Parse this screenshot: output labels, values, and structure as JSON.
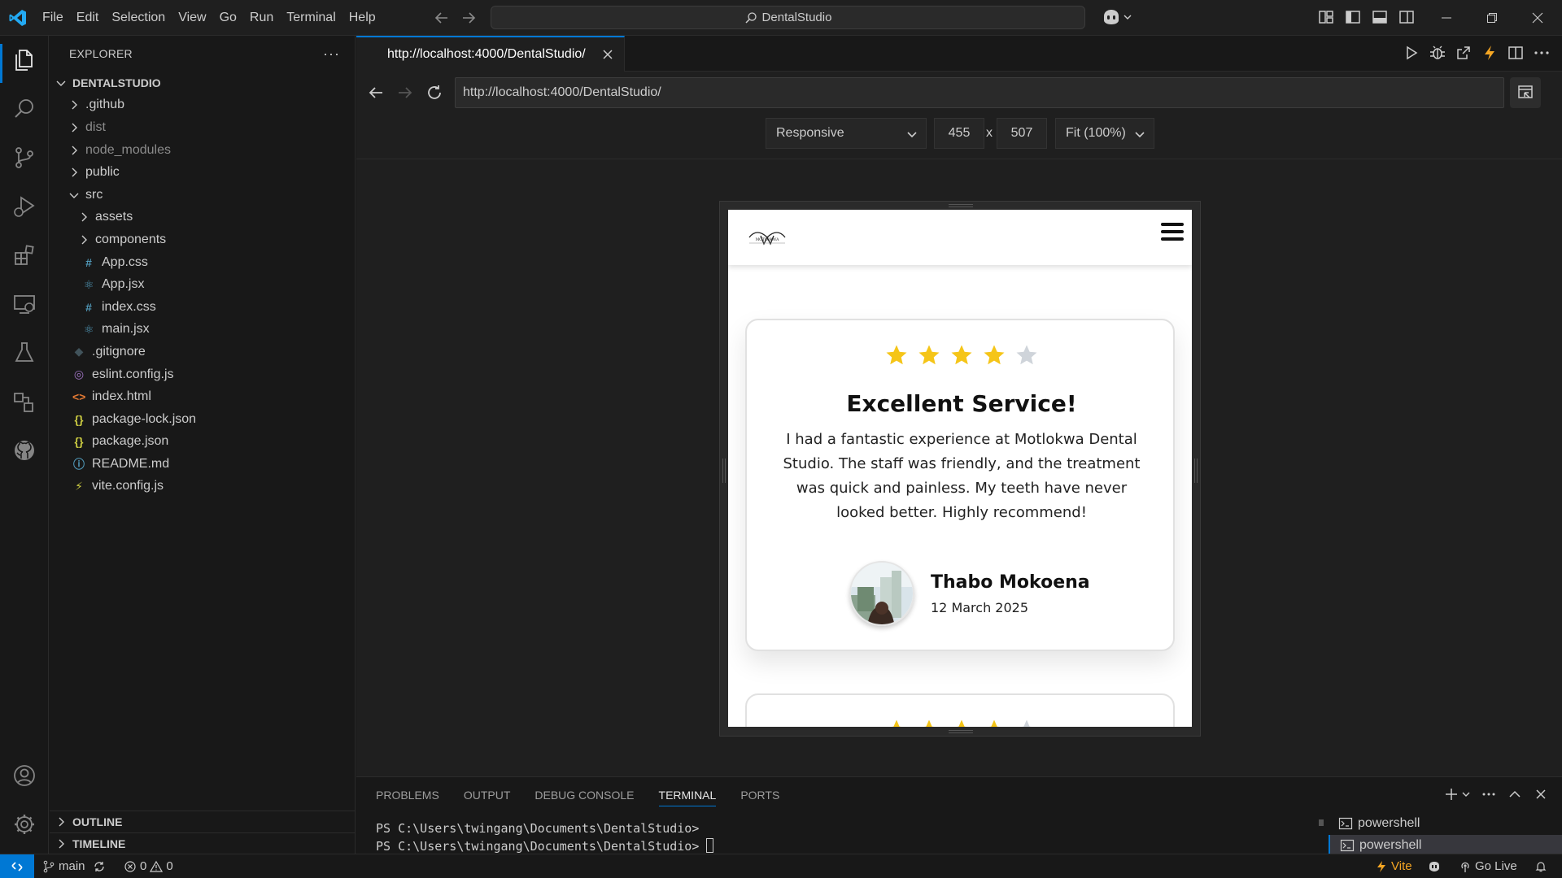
{
  "titlebar": {
    "menu": [
      "File",
      "Edit",
      "Selection",
      "View",
      "Go",
      "Run",
      "Terminal",
      "Help"
    ],
    "search_text": "DentalStudio",
    "icons": [
      "vscode-logo-icon",
      "arrow-left-icon",
      "arrow-right-icon",
      "search-icon",
      "copilot-icon",
      "customize-layout-icon",
      "toggle-sidebar-icon",
      "toggle-panel-icon",
      "toggle-secondary-sidebar-icon",
      "minimize-icon",
      "restore-icon",
      "close-icon"
    ]
  },
  "activitybar": {
    "items": [
      "explorer",
      "search",
      "source-control",
      "run-debug",
      "extensions",
      "remote-explorer",
      "testing",
      "live-share",
      "github"
    ],
    "bottom": [
      "accounts",
      "manage"
    ]
  },
  "sidebar": {
    "header": "EXPLORER",
    "more_label": "···",
    "root": "DENTALSTUDIO",
    "tree": [
      {
        "label": ".github",
        "type": "folder",
        "open": false,
        "depth": 1,
        "muted": false
      },
      {
        "label": "dist",
        "type": "folder",
        "open": false,
        "depth": 1,
        "muted": true
      },
      {
        "label": "node_modules",
        "type": "folder",
        "open": false,
        "depth": 1,
        "muted": true
      },
      {
        "label": "public",
        "type": "folder",
        "open": false,
        "depth": 1,
        "muted": false
      },
      {
        "label": "src",
        "type": "folder",
        "open": true,
        "depth": 1,
        "muted": false
      },
      {
        "label": "assets",
        "type": "folder",
        "open": false,
        "depth": 2,
        "muted": false
      },
      {
        "label": "components",
        "type": "folder",
        "open": false,
        "depth": 2,
        "muted": false
      },
      {
        "label": "App.css",
        "type": "css",
        "depth": 2
      },
      {
        "label": "App.jsx",
        "type": "react",
        "depth": 2
      },
      {
        "label": "index.css",
        "type": "css",
        "depth": 2
      },
      {
        "label": "main.jsx",
        "type": "react",
        "depth": 2
      },
      {
        "label": ".gitignore",
        "type": "git",
        "depth": 1
      },
      {
        "label": "eslint.config.js",
        "type": "eslint",
        "depth": 1
      },
      {
        "label": "index.html",
        "type": "html",
        "depth": 1
      },
      {
        "label": "package-lock.json",
        "type": "json",
        "depth": 1
      },
      {
        "label": "package.json",
        "type": "json",
        "depth": 1
      },
      {
        "label": "README.md",
        "type": "info",
        "depth": 1
      },
      {
        "label": "vite.config.js",
        "type": "vite",
        "depth": 1
      }
    ],
    "sections": [
      "OUTLINE",
      "TIMELINE"
    ],
    "icon_glyphs": {
      "css": "#",
      "react": "⚛",
      "git": "◆",
      "eslint": "◎",
      "html": "<>",
      "json": "{}",
      "info": "ⓘ",
      "vite": "⚡"
    },
    "icon_colors": {
      "css": "#519aba",
      "react": "#519aba",
      "git": "#41535b",
      "eslint": "#a074c4",
      "html": "#e37933",
      "json": "#cbcb41",
      "info": "#519aba",
      "vite": "#cbcb41"
    }
  },
  "editor": {
    "tab_label": "http://localhost:4000/DentalStudio/",
    "url": "http://localhost:4000/DentalStudio/",
    "device": "Responsive",
    "width": "455",
    "height": "507",
    "dim_separator": "x",
    "zoom": "Fit (100%)"
  },
  "preview": {
    "logo_text": "MOTLOKWA",
    "testimonial": {
      "rating": 4,
      "max_rating": 5,
      "title": "Excellent Service!",
      "text": "I had a fantastic experience at Motlokwa Dental Studio. The staff was friendly, and the treatment was quick and painless. My teeth have never looked better. Highly recommend!",
      "author": "Thabo Mokoena",
      "date": "12 March 2025"
    },
    "colors": {
      "star_on": "#f5c518",
      "star_off": "#cfd4da"
    }
  },
  "panel": {
    "tabs": [
      "PROBLEMS",
      "OUTPUT",
      "DEBUG CONSOLE",
      "TERMINAL",
      "PORTS"
    ],
    "active_tab": "TERMINAL",
    "terminal_lines": [
      "PS C:\\Users\\twingang\\Documents\\DentalStudio>",
      "PS C:\\Users\\twingang\\Documents\\DentalStudio>"
    ],
    "terminals": [
      "powershell",
      "powershell"
    ]
  },
  "statusbar": {
    "branch": "main",
    "errors": "0",
    "warnings": "0",
    "vite": "Vite",
    "golive": "Go Live"
  },
  "colors": {
    "accent": "#0078d4",
    "background": "#181818",
    "editor_bg": "#1f1f1f",
    "vite": "#f5a623"
  }
}
